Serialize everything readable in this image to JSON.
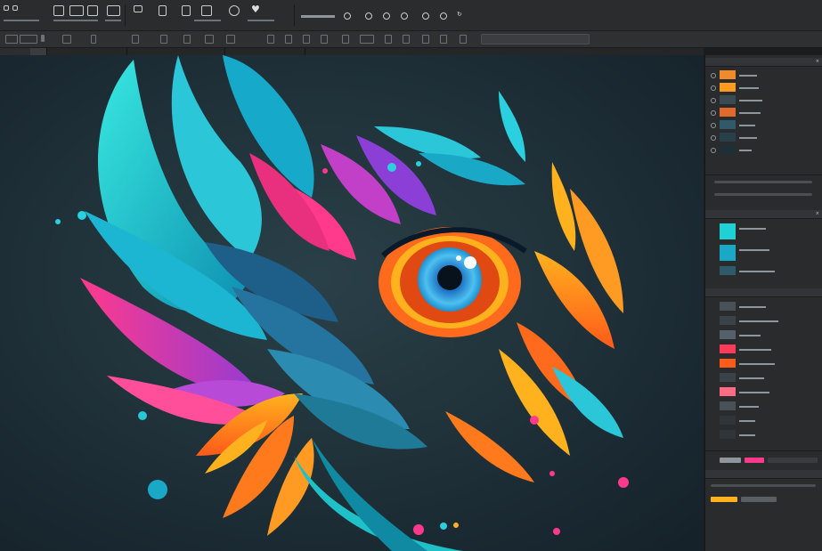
{
  "colors": {
    "accent": "#1fd1d4",
    "canvas_bg": "#203138",
    "ui_dark": "#2a2b2d"
  },
  "toolbar": {
    "tools": [
      {
        "icon": "selection-icon",
        "label": "",
        "small": ""
      },
      {
        "icon": "image-icon",
        "label": "",
        "small": ""
      },
      {
        "icon": "layers-icon",
        "label": "",
        "small": ""
      },
      {
        "icon": "camera-icon",
        "label": "",
        "small": ""
      },
      {
        "icon": "document-icon",
        "label": "",
        "small": ""
      },
      {
        "icon": "clip-icon",
        "label": "",
        "small": ""
      },
      {
        "icon": "crop-icon",
        "label": "",
        "small": ""
      },
      {
        "icon": "search-icon",
        "label": "",
        "small": ""
      },
      {
        "icon": "heart-icon",
        "label": "",
        "small": ""
      },
      {
        "icon": "circle-icon",
        "label": "",
        "small": ""
      },
      {
        "icon": "circle-icon",
        "label": "",
        "small": ""
      },
      {
        "icon": "rotate-icon",
        "label": "",
        "small": ""
      }
    ]
  },
  "panel": {
    "layers_title": "",
    "properties_title": "",
    "adjustments_title": "",
    "close_symbol": "×"
  }
}
